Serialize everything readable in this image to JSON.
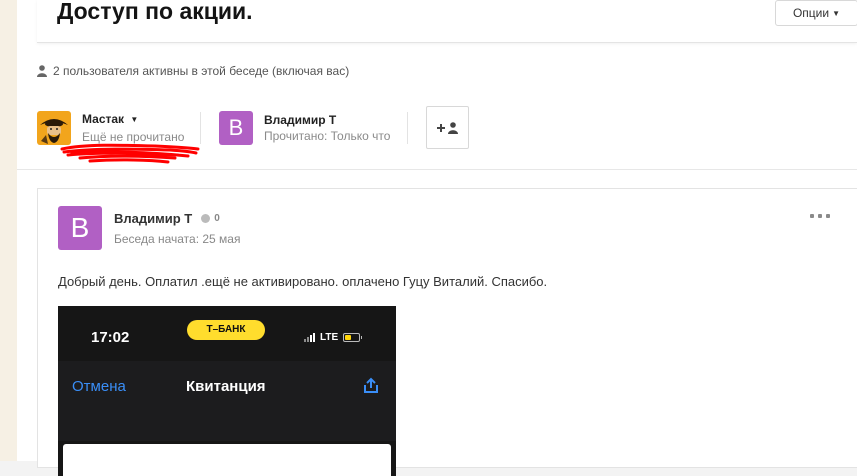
{
  "header": {
    "title": "Доступ по акции.",
    "options_label": "Опции"
  },
  "conversation": {
    "active_users_text": "2 пользователя активны в этой беседе (включая вас)"
  },
  "participants": [
    {
      "name": "Мастак",
      "status": "Ещё не прочитано"
    },
    {
      "name": "Владимир Т",
      "status": "Прочитано: Только что",
      "avatar_letter": "B"
    }
  ],
  "message": {
    "avatar_letter": "B",
    "author": "Владимир Т",
    "reputation": "0",
    "meta": "Беседа начата: 25 мая",
    "text": "Добрый день. Оплатил .ещё не активировано. оплачено Гуцу Виталий. Спасибо."
  },
  "attachment": {
    "time": "17:02",
    "bank_label": "Т–БАНК",
    "network": "LTE",
    "nav_cancel": "Отмена",
    "nav_title": "Квитанция"
  },
  "colors": {
    "avatar_purple": "#b160c4",
    "bank_yellow": "#ffdd2d",
    "ios_blue": "#3a8ef7",
    "redaction_red": "#ff0000"
  }
}
